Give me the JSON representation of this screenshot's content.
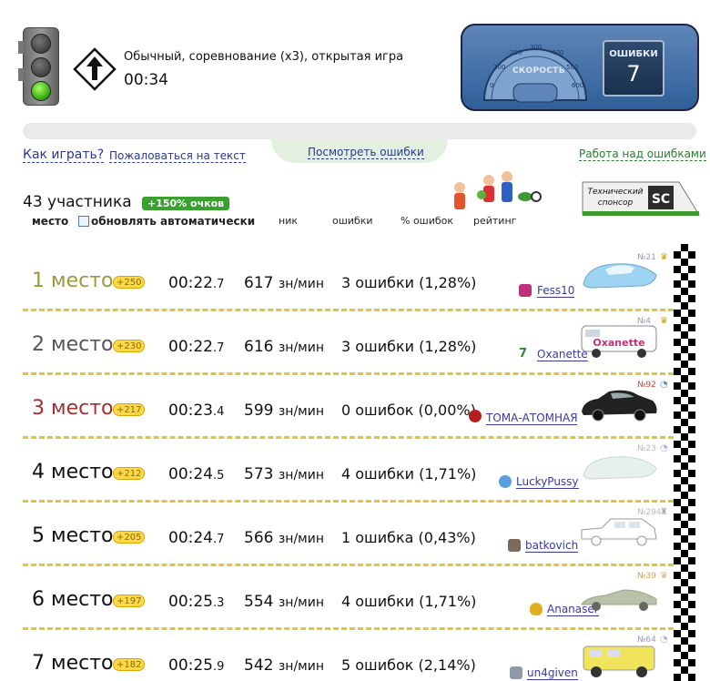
{
  "header": {
    "mode_title": "Обычный, соревнование (x3), открытая игра",
    "timer": "00:34",
    "speedometer_label": "СКОРОСТЬ",
    "speedometer_ticks": [
      "0",
      "100",
      "200",
      "300",
      "400",
      "500",
      "600"
    ],
    "errors_label": "ОШИБКИ",
    "errors_count": "7"
  },
  "links": {
    "how_to_play": "Как играть?",
    "report_text": "Пожаловаться на текст",
    "show_errors": "Посмотреть ошибки",
    "work_on_errors": "Работа над ошибками"
  },
  "participants": {
    "count_label": "43 участника",
    "bonus_badge": "+150% очков",
    "col_place": "место",
    "auto_update_label": "обновлять автоматически",
    "col_nick": "ник",
    "col_errors": "ошибки",
    "col_error_pct": "% ошибок",
    "col_rating": "рейтинг"
  },
  "sponsor": {
    "line1": "Технический",
    "line2": "спонсор",
    "logo": "SC"
  },
  "rows": [
    {
      "place": "1 место",
      "coins": "+250",
      "time_main": "00:22",
      "time_frac": ".7",
      "speed": "617",
      "speed_unit": "зн/мин",
      "errors": "3 ошибки (1,28%)",
      "nick": "Fess10",
      "car_no": "№21",
      "crown": "♛"
    },
    {
      "place": "2 место",
      "coins": "+230",
      "time_main": "00:22",
      "time_frac": ".7",
      "speed": "616",
      "speed_unit": "зн/мин",
      "errors": "3 ошибки (1,28%)",
      "nick": "Oxanette",
      "car_no": "№4",
      "crown": "♛",
      "car_text": "Oxanette"
    },
    {
      "place": "3 место",
      "coins": "+217",
      "time_main": "00:23",
      "time_frac": ".4",
      "speed": "599",
      "speed_unit": "зн/мин",
      "errors": "0 ошибок (0,00%)",
      "nick": "ТОМА-АТОМНАЯ",
      "car_no": "№92",
      "crown": "◔"
    },
    {
      "place": "4 место",
      "coins": "+212",
      "time_main": "00:24",
      "time_frac": ".5",
      "speed": "573",
      "speed_unit": "зн/мин",
      "errors": "4 ошибки (1,71%)",
      "nick": "LuckyPussy",
      "car_no": "№23",
      "crown": "◔"
    },
    {
      "place": "5 место",
      "coins": "+205",
      "time_main": "00:24",
      "time_frac": ".7",
      "speed": "566",
      "speed_unit": "зн/мин",
      "errors": "1 ошибка (0,43%)",
      "nick": "batkovich",
      "car_no": "№294",
      "crown": "♜"
    },
    {
      "place": "6 место",
      "coins": "+197",
      "time_main": "00:25",
      "time_frac": ".3",
      "speed": "554",
      "speed_unit": "зн/мин",
      "errors": "4 ошибки (1,71%)",
      "nick": "Ananaser",
      "car_no": "№39",
      "crown": "♛"
    },
    {
      "place": "7 место",
      "coins": "+182",
      "time_main": "00:25",
      "time_frac": ".9",
      "speed": "542",
      "speed_unit": "зн/мин",
      "errors": "5 ошибок (2,14%)",
      "nick": "un4given",
      "car_no": "№64",
      "crown": "◔"
    }
  ]
}
